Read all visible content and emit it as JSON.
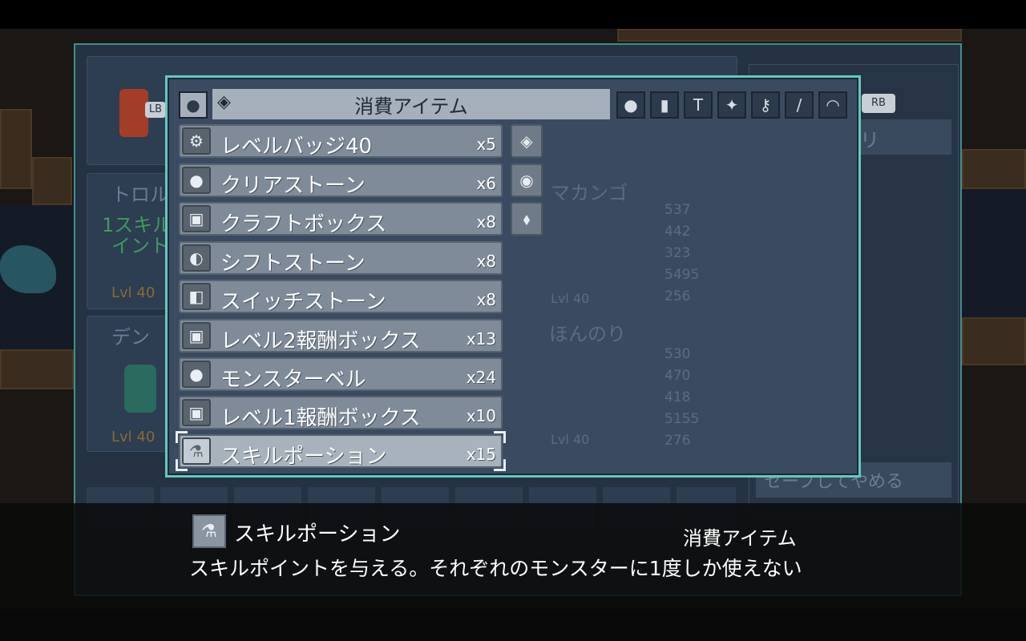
{
  "background": {
    "lb_label": "LB",
    "rb_label": "RB",
    "left_cards": [
      {
        "name": "トロル",
        "line1": "1スキル",
        "line2": "イント",
        "level": "Lvl 40"
      },
      {
        "name": "デン",
        "level": "Lvl 40"
      }
    ],
    "center_cards": [
      {
        "name": "マカンゴ",
        "stats": [
          "537",
          "442",
          "323",
          "5495",
          "256"
        ],
        "level": "Lvl 40"
      },
      {
        "name": "ほんのり",
        "stats": [
          "530",
          "470",
          "418",
          "5155",
          "276"
        ],
        "level": "Lvl 40"
      }
    ],
    "right_menu": {
      "header": "インベントリ",
      "bottom": "セーブしてやめる"
    }
  },
  "item_panel": {
    "title": "消費アイテム",
    "tabs": [
      {
        "icon": "potion-drop-icon",
        "glyph": "●"
      },
      {
        "icon": "crystal-icon",
        "glyph": "◈"
      },
      {
        "icon": "bomb-icon",
        "glyph": "●"
      },
      {
        "icon": "bottle-icon",
        "glyph": "▮"
      },
      {
        "icon": "hammer-icon",
        "glyph": "T"
      },
      {
        "icon": "sparkle-icon",
        "glyph": "✦"
      },
      {
        "icon": "key-icon",
        "glyph": "⚷"
      },
      {
        "icon": "sword-icon",
        "glyph": "/"
      },
      {
        "icon": "helmet-icon",
        "glyph": "◠"
      }
    ],
    "items": [
      {
        "name": "レベルバッジ40",
        "qty": "x5",
        "icon": "badge-icon",
        "glyph": "⚙"
      },
      {
        "name": "クリアストーン",
        "qty": "x6",
        "icon": "stone-icon",
        "glyph": "●"
      },
      {
        "name": "クラフトボックス",
        "qty": "x8",
        "icon": "box-icon",
        "glyph": "▣"
      },
      {
        "name": "シフトストーン",
        "qty": "x8",
        "icon": "shift-stone-icon",
        "glyph": "◐"
      },
      {
        "name": "スイッチストーン",
        "qty": "x8",
        "icon": "switch-stone-icon",
        "glyph": "◧"
      },
      {
        "name": "レベル2報酬ボックス",
        "qty": "x13",
        "icon": "reward-box-icon",
        "glyph": "▣"
      },
      {
        "name": "モンスターベル",
        "qty": "x24",
        "icon": "bell-icon",
        "glyph": "●"
      },
      {
        "name": "レベル1報酬ボックス",
        "qty": "x10",
        "icon": "reward-box-icon",
        "glyph": "▣"
      },
      {
        "name": "スキルポーション",
        "qty": "x15",
        "icon": "potion-icon",
        "glyph": "⚗",
        "selected": true
      }
    ],
    "side_icons": [
      {
        "icon": "crystal-icon",
        "glyph": "◈"
      },
      {
        "icon": "orb-icon",
        "glyph": "◉"
      },
      {
        "icon": "gem-icon",
        "glyph": "⬧"
      }
    ]
  },
  "description": {
    "item_name": "スキルポーション",
    "category": "消費アイテム",
    "text": "スキルポイントを与える。それぞれのモンスターに1度しか使えない",
    "icon": "potion-icon",
    "glyph": "⚗"
  },
  "colors": {
    "panel_border": "#66c7bc",
    "panel_bg": "#3a4b61",
    "row_bg": "#7f8b98",
    "row_selected": "#a8b2bc"
  }
}
